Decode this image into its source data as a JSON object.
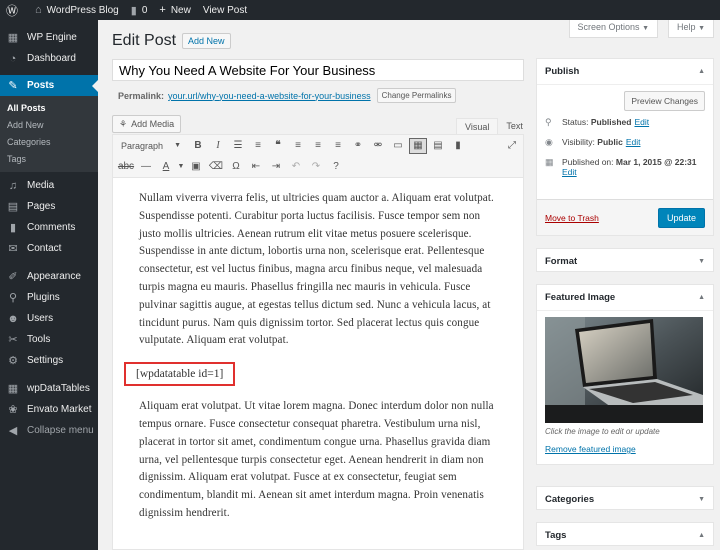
{
  "admin_bar": {
    "site_name": "WordPress Blog",
    "comments_count": "0",
    "new_label": "New",
    "view_post": "View Post"
  },
  "sidebar": {
    "items": [
      {
        "label": "WP Engine",
        "icon": "wp-engine-icon"
      },
      {
        "label": "Dashboard",
        "icon": "dashboard-icon"
      },
      {
        "label": "Posts",
        "icon": "pushpin-icon"
      },
      {
        "label": "Media",
        "icon": "media-icon"
      },
      {
        "label": "Pages",
        "icon": "pages-icon"
      },
      {
        "label": "Comments",
        "icon": "comments-icon"
      },
      {
        "label": "Contact",
        "icon": "contact-icon"
      },
      {
        "label": "Appearance",
        "icon": "appearance-icon"
      },
      {
        "label": "Plugins",
        "icon": "plugins-icon"
      },
      {
        "label": "Users",
        "icon": "users-icon"
      },
      {
        "label": "Tools",
        "icon": "tools-icon"
      },
      {
        "label": "Settings",
        "icon": "settings-icon"
      },
      {
        "label": "wpDataTables",
        "icon": "table-icon"
      },
      {
        "label": "Envato Market",
        "icon": "envato-icon"
      },
      {
        "label": "Collapse menu",
        "icon": "collapse-icon"
      }
    ],
    "posts_submenu": [
      "All Posts",
      "Add New",
      "Categories",
      "Tags"
    ]
  },
  "header": {
    "screen_options": "Screen Options",
    "help": "Help",
    "title": "Edit Post",
    "add_new": "Add New"
  },
  "post": {
    "title": "Why You Need A Website For Your Business",
    "permalink_label": "Permalink:",
    "permalink_url": "your.url/why-you-need-a-website-for-your-business",
    "change_permalinks": "Change Permalinks"
  },
  "editor": {
    "add_media": "Add Media",
    "tab_visual": "Visual",
    "tab_text": "Text",
    "format_select": "Paragraph",
    "paragraph1": "Nullam viverra viverra felis, ut ultricies quam auctor a. Aliquam erat volutpat. Suspendisse potenti. Curabitur porta luctus facilisis. Fusce tempor sem non justo mollis ultricies. Aenean rutrum elit vitae metus posuere scelerisque. Suspendisse in ante dictum, lobortis urna non, scelerisque erat. Pellentesque consectetur, est vel luctus finibus, magna arcu finibus neque, vel malesuada turpis magna eu mauris. Phasellus fringilla nec mauris in vehicula. Fusce pulvinar sagittis augue, at egestas tellus dictum sed. Nunc a vehicula lacus, at tincidunt purus. Nam quis dignissim tortor. Sed placerat lectus quis congue vulputate. Aliquam erat volutpat.",
    "shortcode": "[wpdatatable id=1]",
    "paragraph2": "Aliquam erat volutpat. Ut vitae lorem magna. Donec interdum dolor non nulla tempus ornare. Fusce consectetur consequat pharetra. Vestibulum urna nisl, placerat in tortor sit amet, condimentum congue urna. Phasellus gravida diam urna, vel pellentesque turpis consectetur eget. Aenean hendrerit in diam non dignissim. Aliquam erat volutpat. Fusce at ex consectetur, feugiat sem condimentum, blandit mi. Aenean sit amet interdum magna. Proin venenatis dignissim hendrerit."
  },
  "publish": {
    "title": "Publish",
    "preview": "Preview Changes",
    "status_label": "Status:",
    "status_value": "Published",
    "visibility_label": "Visibility:",
    "visibility_value": "Public",
    "published_label": "Published on:",
    "published_value": "Mar 1, 2015 @ 22:31",
    "edit": "Edit",
    "trash": "Move to Trash",
    "update": "Update"
  },
  "boxes": {
    "format": "Format",
    "featured_image": "Featured Image",
    "featured_caption": "Click the image to edit or update",
    "remove_featured": "Remove featured image",
    "categories": "Categories",
    "tags": "Tags"
  },
  "colors": {
    "accent": "#0073aa",
    "admin_dark": "#23282d",
    "update_button": "#0085ba",
    "highlight_border": "#e0302e"
  }
}
